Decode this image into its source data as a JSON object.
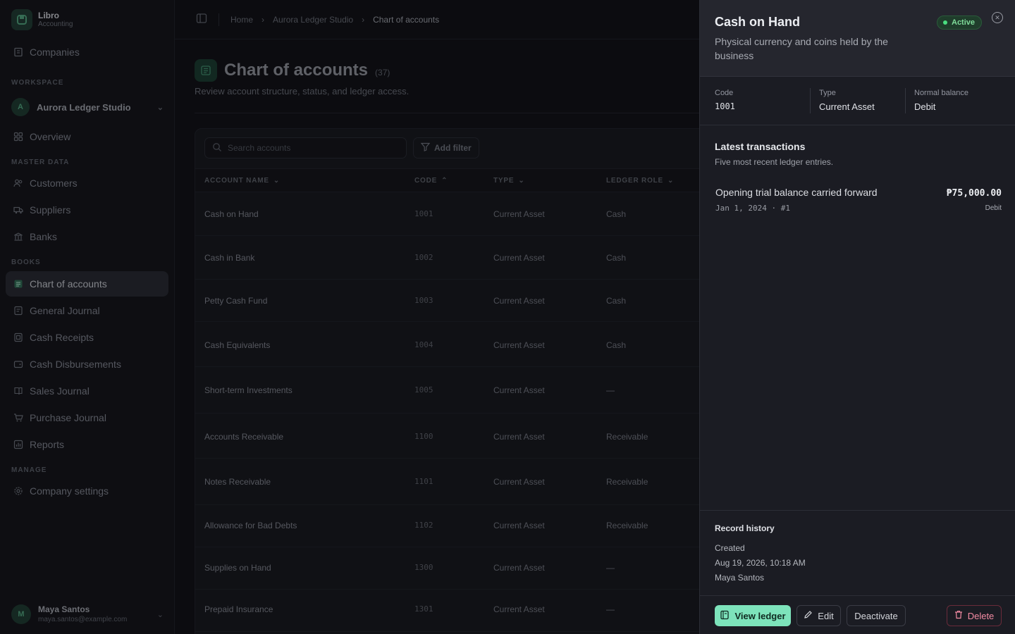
{
  "app": {
    "name": "Libro",
    "subtitle": "Accounting"
  },
  "sidebar": {
    "companies_label": "Companies",
    "workspace_section": "WORKSPACE",
    "workspace": {
      "initial": "A",
      "name": "Aurora Ledger Studio"
    },
    "overview_label": "Overview",
    "master_data_section": "MASTER DATA",
    "master_data": [
      {
        "label": "Customers",
        "icon": "users-icon"
      },
      {
        "label": "Suppliers",
        "icon": "truck-icon"
      },
      {
        "label": "Banks",
        "icon": "bank-icon"
      }
    ],
    "books_section": "BOOKS",
    "books": [
      {
        "label": "Chart of accounts",
        "icon": "list-icon",
        "active": true
      },
      {
        "label": "General Journal",
        "icon": "journal-icon"
      },
      {
        "label": "Cash Receipts",
        "icon": "receipt-icon"
      },
      {
        "label": "Cash Disbursements",
        "icon": "wallet-icon"
      },
      {
        "label": "Sales Journal",
        "icon": "book-icon"
      },
      {
        "label": "Purchase Journal",
        "icon": "cart-icon"
      },
      {
        "label": "Reports",
        "icon": "chart-icon"
      }
    ],
    "manage_section": "MANAGE",
    "settings_label": "Company settings",
    "user": {
      "initial": "M",
      "name": "Maya Santos",
      "email": "maya.santos@example.com"
    }
  },
  "breadcrumb": {
    "home": "Home",
    "company": "Aurora Ledger Studio",
    "current": "Chart of accounts"
  },
  "page": {
    "title": "Chart of accounts",
    "count": "(37)",
    "subtitle": "Review account structure, status, and ledger access."
  },
  "toolbar": {
    "search_placeholder": "Search accounts",
    "filter_label": "Add filter"
  },
  "table": {
    "headers": {
      "name": "ACCOUNT NAME",
      "code": "CODE",
      "type": "TYPE",
      "role": "LEDGER ROLE"
    },
    "rows": [
      {
        "name": "Cash on Hand",
        "code": "1001",
        "type": "Current Asset",
        "role": "Cash"
      },
      {
        "name": "Cash in Bank",
        "code": "1002",
        "type": "Current Asset",
        "role": "Cash"
      },
      {
        "name": "Petty Cash Fund",
        "code": "1003",
        "type": "Current Asset",
        "role": "Cash"
      },
      {
        "name": "Cash Equivalents",
        "code": "1004",
        "type": "Current Asset",
        "role": "Cash"
      },
      {
        "name": "Short-term Investments",
        "code": "1005",
        "type": "Current Asset",
        "role": "—"
      },
      {
        "name": "Accounts Receivable",
        "code": "1100",
        "type": "Current Asset",
        "role": "Receivable"
      },
      {
        "name": "Notes Receivable",
        "code": "1101",
        "type": "Current Asset",
        "role": "Receivable"
      },
      {
        "name": "Allowance for Bad Debts",
        "code": "1102",
        "type": "Current Asset",
        "role": "Receivable"
      },
      {
        "name": "Supplies on Hand",
        "code": "1300",
        "type": "Current Asset",
        "role": "—"
      },
      {
        "name": "Prepaid Insurance",
        "code": "1301",
        "type": "Current Asset",
        "role": "—"
      }
    ]
  },
  "drawer": {
    "title": "Cash on Hand",
    "description": "Physical currency and coins held by the business",
    "status": "Active",
    "status_color": "#4ade80",
    "meta": {
      "code_label": "Code",
      "code": "1001",
      "type_label": "Type",
      "type": "Current Asset",
      "balance_label": "Normal balance",
      "balance": "Debit"
    },
    "transactions_title": "Latest transactions",
    "transactions_subtitle": "Five most recent ledger entries.",
    "transactions": [
      {
        "description": "Opening trial balance carried forward",
        "date": "Jan 1, 2024 · #1",
        "amount": "₱75,000.00",
        "side": "Debit"
      }
    ],
    "history_title": "Record history",
    "history": {
      "label": "Created",
      "timestamp": "Aug 19, 2026, 10:18 AM",
      "by": "Maya Santos"
    },
    "actions": {
      "view_ledger": "View ledger",
      "edit": "Edit",
      "deactivate": "Deactivate",
      "delete": "Delete"
    },
    "accent_color": "#7de3bb",
    "danger_color": "#f38ba3"
  }
}
